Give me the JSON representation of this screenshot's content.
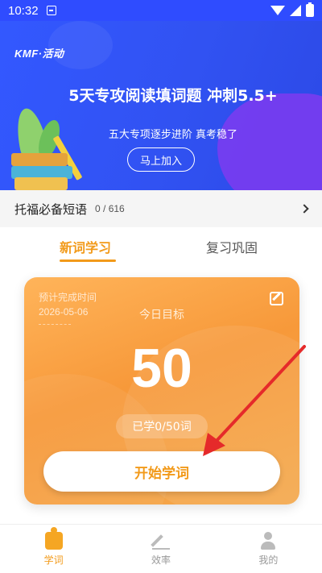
{
  "status_bar": {
    "time": "10:32"
  },
  "banner": {
    "logo": "KMF·活动",
    "headline": "5天专攻阅读填词题 冲刺5.5+",
    "subtitle": "五大专项逐步进阶 真考稳了",
    "join_button": "马上加入"
  },
  "phrase_bar": {
    "title": "托福必备短语",
    "count": "0 / 616"
  },
  "tabs": [
    {
      "label": "新词学习",
      "active": true
    },
    {
      "label": "复习巩固",
      "active": false
    }
  ],
  "card": {
    "estimate_label": "预计完成时间",
    "estimate_date": "2026-05-06",
    "goal_label": "今日目标",
    "goal_number": "50",
    "learned_text": "已学0/50词",
    "start_button": "开始学词"
  },
  "bottom_nav": [
    {
      "label": "学词",
      "icon": "study-icon",
      "active": true
    },
    {
      "label": "效率",
      "icon": "pen-icon",
      "active": false
    },
    {
      "label": "我的",
      "icon": "person-icon",
      "active": false
    }
  ],
  "colors": {
    "accent": "#f29a1a",
    "banner": "#3358ff",
    "annotation_arrow": "#e52a2a"
  }
}
